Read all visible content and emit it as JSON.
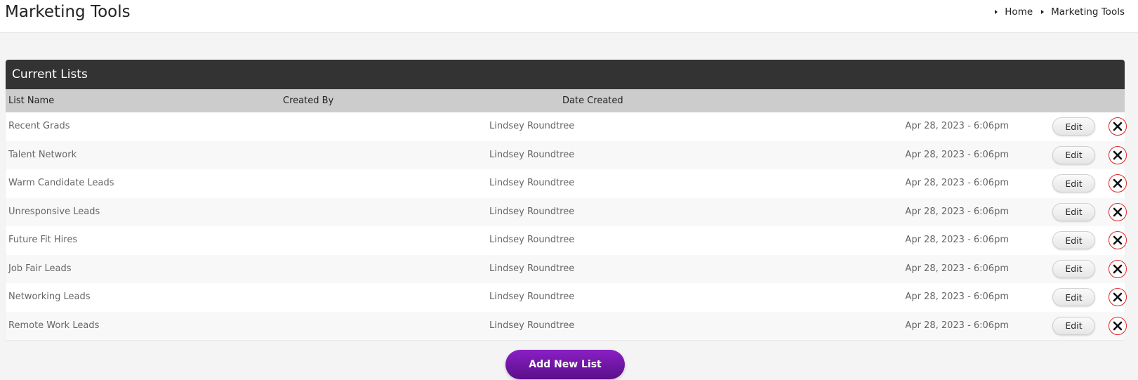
{
  "page": {
    "title": "Marketing Tools"
  },
  "breadcrumb": {
    "items": [
      {
        "label": "Home"
      },
      {
        "label": "Marketing Tools"
      }
    ]
  },
  "lists_panel": {
    "title": "Current Lists",
    "columns": {
      "name": "List Name",
      "created_by": "Created By",
      "date_created": "Date Created"
    },
    "rows": [
      {
        "name": "Recent Grads",
        "created_by": "Lindsey Roundtree",
        "date": "Apr 28, 2023 - 6:06pm",
        "edit_label": "Edit"
      },
      {
        "name": "Talent Network",
        "created_by": "Lindsey Roundtree",
        "date": "Apr 28, 2023 - 6:06pm",
        "edit_label": "Edit"
      },
      {
        "name": "Warm Candidate Leads",
        "created_by": "Lindsey Roundtree",
        "date": "Apr 28, 2023 - 6:06pm",
        "edit_label": "Edit"
      },
      {
        "name": "Unresponsive Leads",
        "created_by": "Lindsey Roundtree",
        "date": "Apr 28, 2023 - 6:06pm",
        "edit_label": "Edit"
      },
      {
        "name": "Future Fit Hires",
        "created_by": "Lindsey Roundtree",
        "date": "Apr 28, 2023 - 6:06pm",
        "edit_label": "Edit"
      },
      {
        "name": "Job Fair Leads",
        "created_by": "Lindsey Roundtree",
        "date": "Apr 28, 2023 - 6:06pm",
        "edit_label": "Edit"
      },
      {
        "name": "Networking Leads",
        "created_by": "Lindsey Roundtree",
        "date": "Apr 28, 2023 - 6:06pm",
        "edit_label": "Edit"
      },
      {
        "name": "Remote Work Leads",
        "created_by": "Lindsey Roundtree",
        "date": "Apr 28, 2023 - 6:06pm",
        "edit_label": "Edit"
      }
    ]
  },
  "actions": {
    "add_new_list_label": "Add New List"
  },
  "icons": {
    "delete": "close-circle-icon",
    "breadcrumb_separator": "caret-right-icon"
  },
  "colors": {
    "panel_header": "#333333",
    "column_header": "#cccccc",
    "primary_button": "#7a1ab3",
    "delete_accent": "#e02424"
  }
}
